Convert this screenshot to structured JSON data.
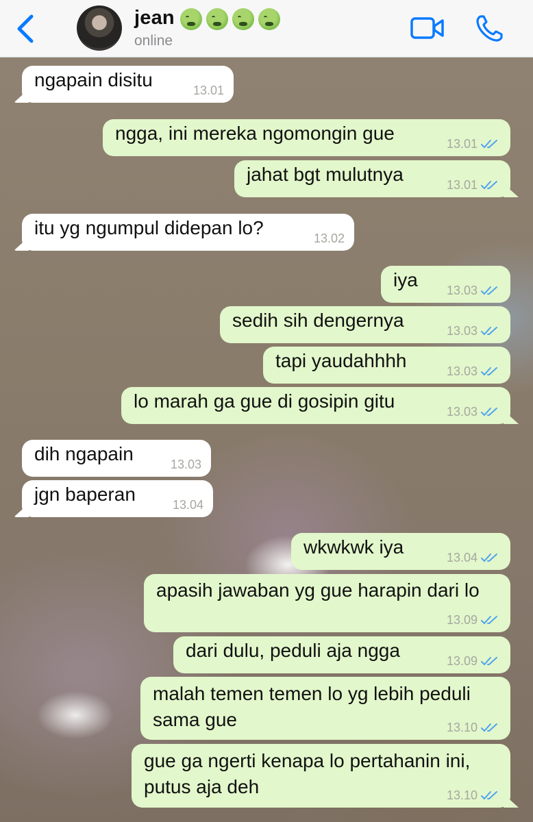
{
  "header": {
    "back_label": "",
    "contact_name": "jean",
    "status": "online",
    "emojis": [
      "nauseated-face",
      "nauseated-face",
      "nauseated-face",
      "nauseated-face"
    ],
    "accent_color": "#0a7aff"
  },
  "messages": [
    {
      "dir": "in",
      "text": "ngapain disitu",
      "time": "13.01"
    },
    {
      "dir": "out",
      "text": "ngga, ini mereka ngomongin gue",
      "time": "13.01"
    },
    {
      "dir": "out",
      "text": "jahat bgt mulutnya",
      "time": "13.01"
    },
    {
      "dir": "in",
      "text": "itu yg ngumpul didepan lo?",
      "time": "13.02"
    },
    {
      "dir": "out",
      "text": "iya",
      "time": "13.03"
    },
    {
      "dir": "out",
      "text": "sedih sih dengernya",
      "time": "13.03"
    },
    {
      "dir": "out",
      "text": "tapi yaudahhhh",
      "time": "13.03"
    },
    {
      "dir": "out",
      "text": "lo marah ga gue di gosipin gitu",
      "time": "13.03"
    },
    {
      "dir": "in",
      "text": "dih ngapain",
      "time": "13.03"
    },
    {
      "dir": "in",
      "text": "jgn baperan",
      "time": "13.04"
    },
    {
      "dir": "out",
      "text": "wkwkwk iya",
      "time": "13.04"
    },
    {
      "dir": "out",
      "text": "apasih jawaban yg gue harapin dari lo",
      "time": "13.09"
    },
    {
      "dir": "out",
      "text": "dari dulu, peduli aja ngga",
      "time": "13.09"
    },
    {
      "dir": "out",
      "text": "malah temen temen lo yg lebih peduli sama gue",
      "time": "13.10"
    },
    {
      "dir": "out",
      "text": "gue ga ngerti kenapa lo pertahanin ini, putus aja deh",
      "time": "13.10"
    }
  ],
  "colors": {
    "outgoing_bubble": "#e2f7cb",
    "incoming_bubble": "#ffffff",
    "read_ticks": "#4fa3f0"
  }
}
